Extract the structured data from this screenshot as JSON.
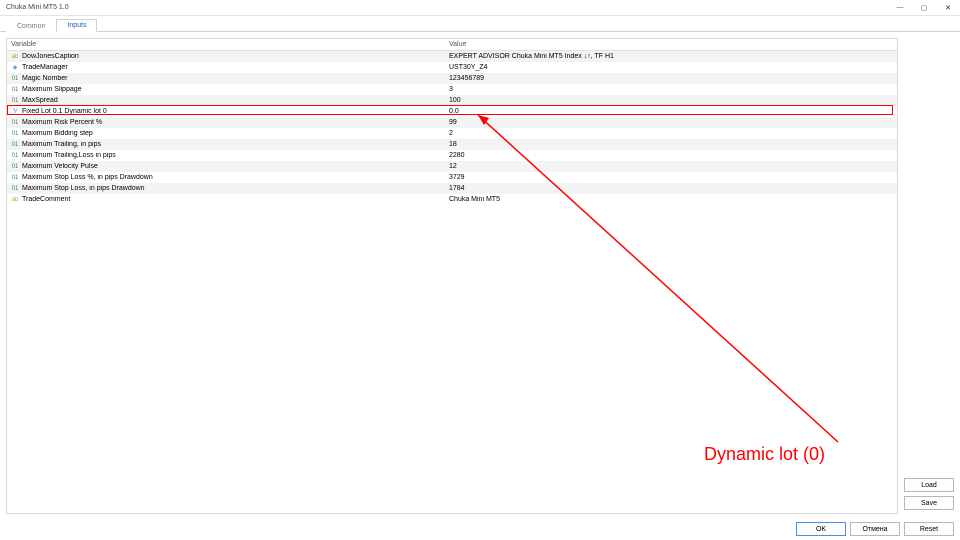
{
  "window": {
    "title": "Chuka Mini MT5 1.0"
  },
  "tabs": {
    "common": "Common",
    "inputs": "Inputs"
  },
  "headers": {
    "variable": "Variable",
    "value": "Value"
  },
  "rows": [
    {
      "icon": "str",
      "name": "DowJonesCaption",
      "value": "EXPERT ADVISOR Chuka Mini MT5 Index ↓↑, TF H1"
    },
    {
      "icon": "ptr",
      "name": "TradeManager",
      "value": "UST30Y_Z4"
    },
    {
      "icon": "int",
      "name": "Magic Nomber",
      "value": "123456789"
    },
    {
      "icon": "int",
      "name": "Maximum Slippage",
      "value": "3"
    },
    {
      "icon": "int",
      "name": "MaxSpread",
      "value": "100"
    },
    {
      "icon": "dbl",
      "name": "Fixed Lot 0.1 Dynamic lot 0",
      "value": "0.0"
    },
    {
      "icon": "int",
      "name": "Maximum Risk Percent %",
      "value": "99"
    },
    {
      "icon": "int",
      "name": "Maximum Bidding step",
      "value": "2"
    },
    {
      "icon": "int",
      "name": "Maximum Trailing, in pips",
      "value": "18"
    },
    {
      "icon": "int",
      "name": "Maximum Trailing,Loss in pips",
      "value": "2280"
    },
    {
      "icon": "int",
      "name": "Maximum Velocity Pulse",
      "value": "12"
    },
    {
      "icon": "int",
      "name": "Maximum Stop Loss %, in pips Drawdown",
      "value": "3729"
    },
    {
      "icon": "int",
      "name": "Maximum Stop Loss, in pips Drawdown",
      "value": "1784"
    },
    {
      "icon": "str",
      "name": "TradeComment",
      "value": "Chuka Mini MT5"
    }
  ],
  "annotation": {
    "text": "Dynamic lot (0)"
  },
  "buttons": {
    "load": "Load",
    "save": "Save",
    "ok": "OK",
    "cancel": "Отмена",
    "reset": "Reset"
  },
  "glyphs": {
    "min": "—",
    "max": "▢",
    "close": "✕"
  }
}
